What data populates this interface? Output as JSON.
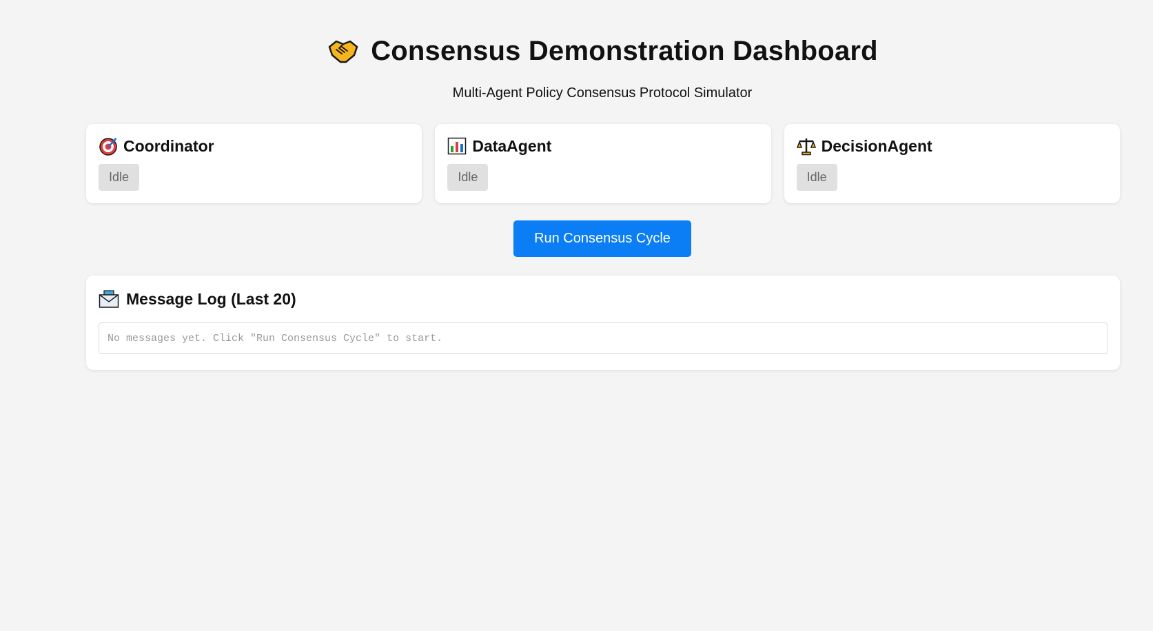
{
  "header": {
    "title": "Consensus Demonstration Dashboard",
    "title_icon": "handshake-icon",
    "subtitle": "Multi-Agent Policy Consensus Protocol Simulator"
  },
  "agents": [
    {
      "name": "Coordinator",
      "icon": "target-icon",
      "status": "Idle"
    },
    {
      "name": "DataAgent",
      "icon": "bar-chart-icon",
      "status": "Idle"
    },
    {
      "name": "DecisionAgent",
      "icon": "scales-icon",
      "status": "Idle"
    }
  ],
  "controls": {
    "run_label": "Run Consensus Cycle"
  },
  "message_log": {
    "title": "Message Log (Last 20)",
    "icon": "envelope-icon",
    "empty_text": "No messages yet. Click \"Run Consensus Cycle\" to start."
  },
  "colors": {
    "background": "#f4f4f4",
    "accent": "#0b7ef5",
    "badge_bg": "#e0e0e0",
    "badge_text": "#666666"
  }
}
